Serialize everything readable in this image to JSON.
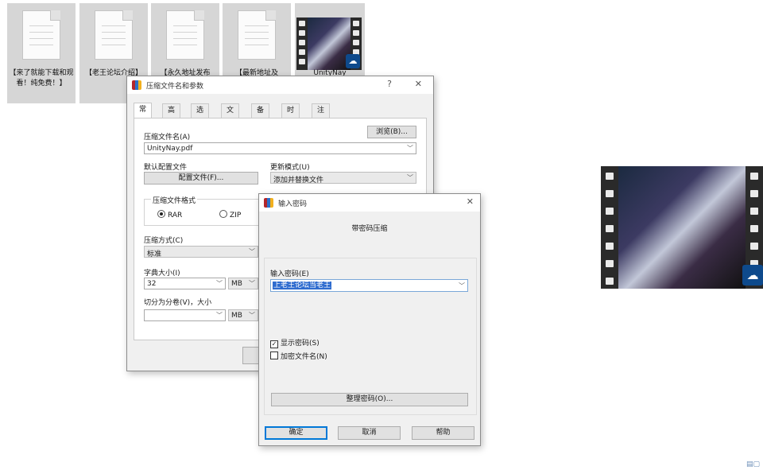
{
  "desktop": {
    "icons": [
      {
        "label": "【来了就能下载和观看！纯免费！】"
      },
      {
        "label": "【老王论坛介绍】"
      },
      {
        "label": "【永久地址发布"
      },
      {
        "label": "【最新地址及"
      },
      {
        "label": "UnityNay"
      }
    ],
    "badge_icon": "cloud-app-icon"
  },
  "archive_dialog": {
    "title": "压缩文件名和参数",
    "help_btn": "?",
    "close_btn": "✕",
    "tabs": [
      "常规",
      "高级",
      "选项",
      "文件",
      "备份",
      "时间",
      "注释"
    ],
    "archive_name_label": "压缩文件名(A)",
    "archive_name_value": "UnityNay.pdf",
    "browse_button": "浏览(B)...",
    "default_profile_label": "默认配置文件",
    "profile_button": "配置文件(F)...",
    "update_mode_label": "更新模式(U)",
    "update_mode_value": "添加并替换文件",
    "format_group_label": "压缩文件格式",
    "format_rar": "RAR",
    "format_zip": "ZIP",
    "method_label": "压缩方式(C)",
    "method_value": "标准",
    "dict_label": "字典大小(I)",
    "dict_value": "32",
    "dict_unit": "MB",
    "split_label": "切分为分卷(V)，大小",
    "split_value": "",
    "split_unit": "MB"
  },
  "password_dialog": {
    "title": "输入密码",
    "close_btn": "✕",
    "heading": "带密码压缩",
    "password_label": "输入密码(E)",
    "password_value": "上老王论坛当老王",
    "show_password_label": "显示密码(S)",
    "show_password_checked": true,
    "encrypt_names_label": "加密文件名(N)",
    "encrypt_names_checked": false,
    "organize_button": "整理密码(O)...",
    "ok_button": "确定",
    "cancel_button": "取消",
    "help_button": "帮助"
  }
}
